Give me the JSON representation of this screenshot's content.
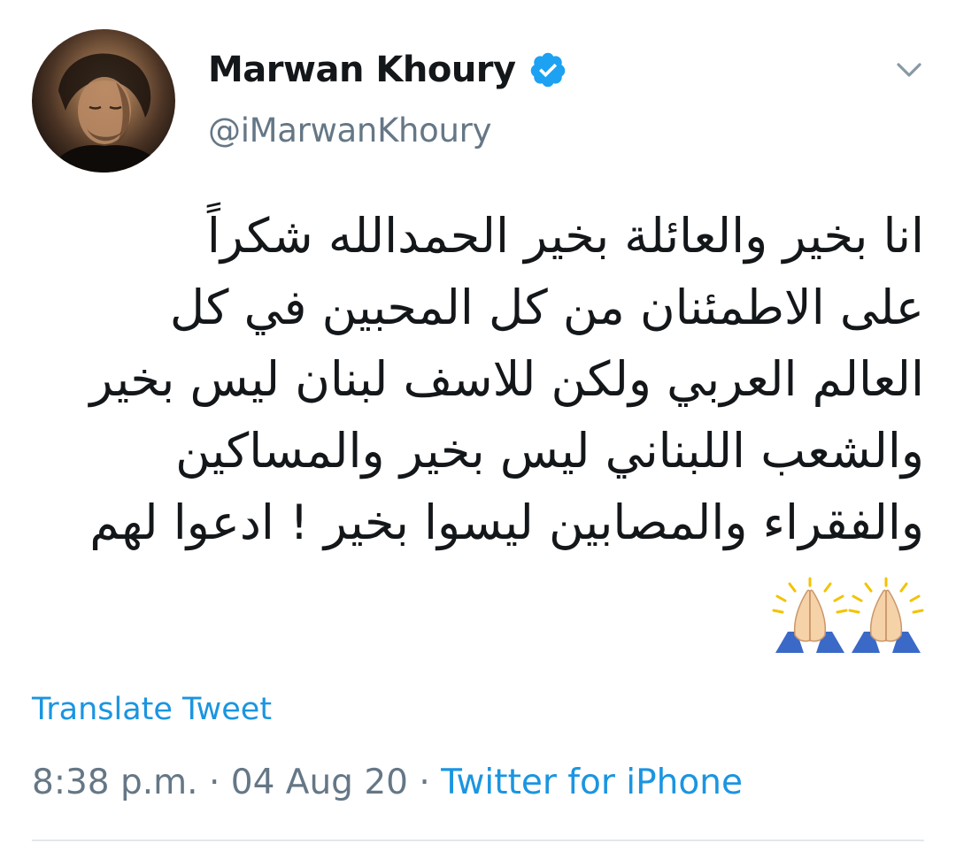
{
  "user": {
    "display_name": "Marwan Khoury",
    "handle": "@iMarwanKhoury",
    "verified": true
  },
  "tweet": {
    "text": "انا بخير والعائلة بخير الحمدالله شكراً\nعلى الاطمئنان من كل المحبين في كل\nالعالم العربي ولكن للاسف لبنان ليس بخير\nوالشعب اللبناني ليس بخير والمساكين\nوالفقراء والمصابين ليسوا بخير ! ادعوا لهم",
    "emoji": [
      "folded-hands",
      "folded-hands"
    ],
    "translate_label": "Translate Tweet",
    "time": "8:38 p.m.",
    "separator": "·",
    "date": "04 Aug 20",
    "source": "Twitter for iPhone"
  },
  "colors": {
    "link": "#1b95e0",
    "secondary_text": "#657786",
    "verified": "#1da1f2",
    "divider": "#e1e8ed"
  },
  "icons": {
    "verified": "verified-badge-icon",
    "menu": "chevron-down-icon"
  }
}
